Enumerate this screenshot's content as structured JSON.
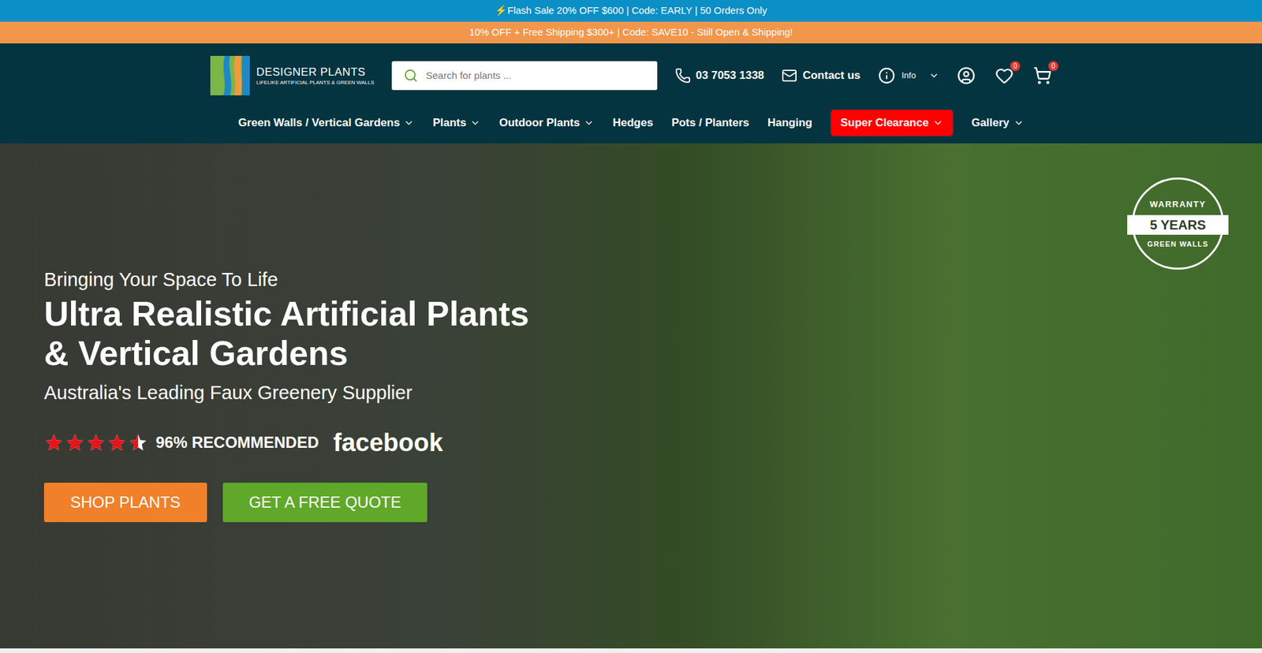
{
  "announcements": [
    {
      "text": "⚡Flash Sale 20% OFF $600 | Code: EARLY | 50 Orders Only",
      "color": "#0a8fc6"
    },
    {
      "text": "10% OFF + Free Shipping $300+ | Code: SAVE10 - Still Open & Shipping!",
      "color": "#f2964b"
    }
  ],
  "logo": {
    "name": "DESIGNER PLANTS",
    "tagline": "LIFELIKE ARTIFICIAL PLANTS & GREEN WALLS"
  },
  "search": {
    "placeholder": "Search for plants ..."
  },
  "phone": "03 7053 1338",
  "contact": "Contact us",
  "info": "Info",
  "wishlist_count": "0",
  "cart_count": "0",
  "nav": [
    {
      "label": "Green Walls / Vertical Gardens",
      "dropdown": true,
      "highlighted": false
    },
    {
      "label": "Plants",
      "dropdown": true,
      "highlighted": false
    },
    {
      "label": "Outdoor Plants",
      "dropdown": true,
      "highlighted": false
    },
    {
      "label": "Hedges",
      "dropdown": false,
      "highlighted": false
    },
    {
      "label": "Pots / Planters",
      "dropdown": false,
      "highlighted": false
    },
    {
      "label": "Hanging",
      "dropdown": false,
      "highlighted": false
    },
    {
      "label": "Super Clearance",
      "dropdown": true,
      "highlighted": true
    },
    {
      "label": "Gallery",
      "dropdown": true,
      "highlighted": false
    }
  ],
  "hero": {
    "eyebrow": "Bringing Your Space To Life",
    "title": [
      "Ultra Realistic Artificial Plants",
      "& Vertical Gardens"
    ],
    "subtitle": "Australia's Leading Faux Greenery Supplier",
    "rating": {
      "stars": 4.5,
      "label": "96% RECOMMENDED",
      "source": "facebook"
    },
    "buttons": [
      {
        "label": "SHOP PLANTS",
        "color": "#f0802a"
      },
      {
        "label": "GET A FREE QUOTE",
        "color": "#5fa82a"
      }
    ],
    "badge": {
      "top": "WARRANTY",
      "middle": "5 YEARS",
      "bottom": "GREEN WALLS"
    }
  }
}
